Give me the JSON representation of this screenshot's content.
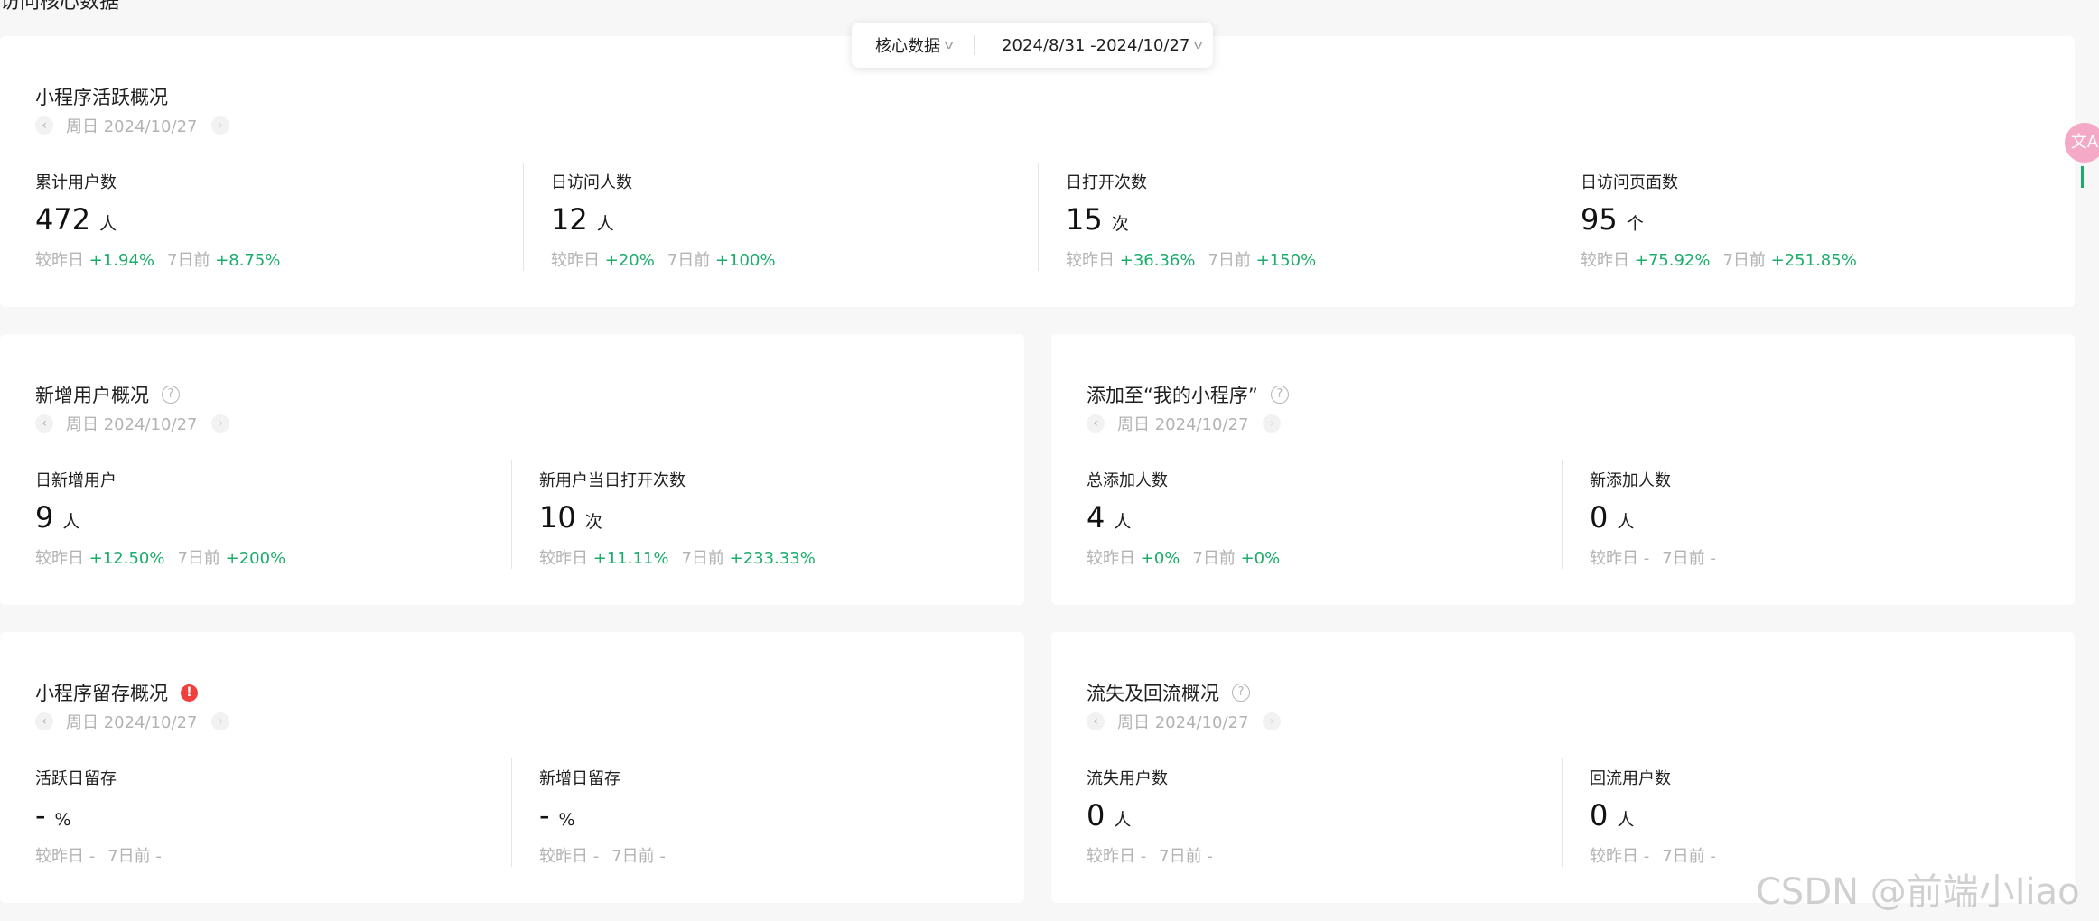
{
  "page": {
    "header_title": "访问核心数据"
  },
  "toolbar": {
    "data_select": "核心数据",
    "date_range": "2024/8/31 -2024/10/27"
  },
  "colors": {
    "positive": "#1aad6a",
    "muted": "#b3b3b3",
    "warning": "#f0403d"
  },
  "common": {
    "compare_day_label": "较昨日",
    "compare_week_label": "7日前"
  },
  "sections": {
    "active": {
      "title": "小程序活跃概况",
      "date": "周日 2024/10/27",
      "metrics": [
        {
          "label": "累计用户数",
          "value": "472",
          "unit": "人",
          "day": "+1.94%",
          "week": "+8.75%"
        },
        {
          "label": "日访问人数",
          "value": "12",
          "unit": "人",
          "day": "+20%",
          "week": "+100%"
        },
        {
          "label": "日打开次数",
          "value": "15",
          "unit": "次",
          "day": "+36.36%",
          "week": "+150%"
        },
        {
          "label": "日访问页面数",
          "value": "95",
          "unit": "个",
          "day": "+75.92%",
          "week": "+251.85%"
        }
      ]
    },
    "new_users": {
      "title": "新增用户概况",
      "date": "周日 2024/10/27",
      "metrics": [
        {
          "label": "日新增用户",
          "value": "9",
          "unit": "人",
          "day": "+12.50%",
          "week": "+200%"
        },
        {
          "label": "新用户当日打开次数",
          "value": "10",
          "unit": "次",
          "day": "+11.11%",
          "week": "+233.33%"
        }
      ]
    },
    "my_apps": {
      "title": "添加至“我的小程序”",
      "date": "周日 2024/10/27",
      "metrics": [
        {
          "label": "总添加人数",
          "value": "4",
          "unit": "人",
          "day": "+0%",
          "week": "+0%"
        },
        {
          "label": "新添加人数",
          "value": "0",
          "unit": "人",
          "day": "-",
          "week": "-"
        }
      ]
    },
    "retention": {
      "title": "小程序留存概况",
      "date": "周日 2024/10/27",
      "metrics": [
        {
          "label": "活跃日留存",
          "value": "-",
          "unit": "%",
          "day": "-",
          "week": "-"
        },
        {
          "label": "新增日留存",
          "value": "-",
          "unit": "%",
          "day": "-",
          "week": "-"
        }
      ]
    },
    "churn": {
      "title": "流失及回流概况",
      "date": "周日 2024/10/27",
      "metrics": [
        {
          "label": "流失用户数",
          "value": "0",
          "unit": "人",
          "day": "-",
          "week": "-"
        },
        {
          "label": "回流用户数",
          "value": "0",
          "unit": "人",
          "day": "-",
          "week": "-"
        }
      ]
    }
  },
  "watermark": "CSDN @前端小Iiao"
}
